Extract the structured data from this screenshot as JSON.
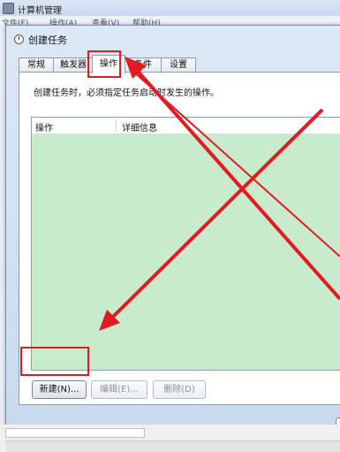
{
  "outer_window": {
    "title": "计算机管理",
    "menu": [
      "文件(F)",
      "操作(A)",
      "查看(V)",
      "帮助(H)"
    ]
  },
  "dialog": {
    "title": "创建任务",
    "tabs": [
      {
        "label": "常规",
        "active": false
      },
      {
        "label": "触发器",
        "active": false
      },
      {
        "label": "操作",
        "active": true
      },
      {
        "label": "条件",
        "active": false
      },
      {
        "label": "设置",
        "active": false
      }
    ],
    "description": "创建任务时，必须指定任务启动时发生的操作。",
    "table": {
      "columns": [
        "操作",
        "详细信息"
      ],
      "rows": []
    },
    "buttons": {
      "new": "新建(N)...",
      "edit": "编辑(E)...",
      "delete": "删除(D)"
    }
  },
  "colors": {
    "table_background": "#c8ebcd",
    "annotation": "#e21b22"
  }
}
